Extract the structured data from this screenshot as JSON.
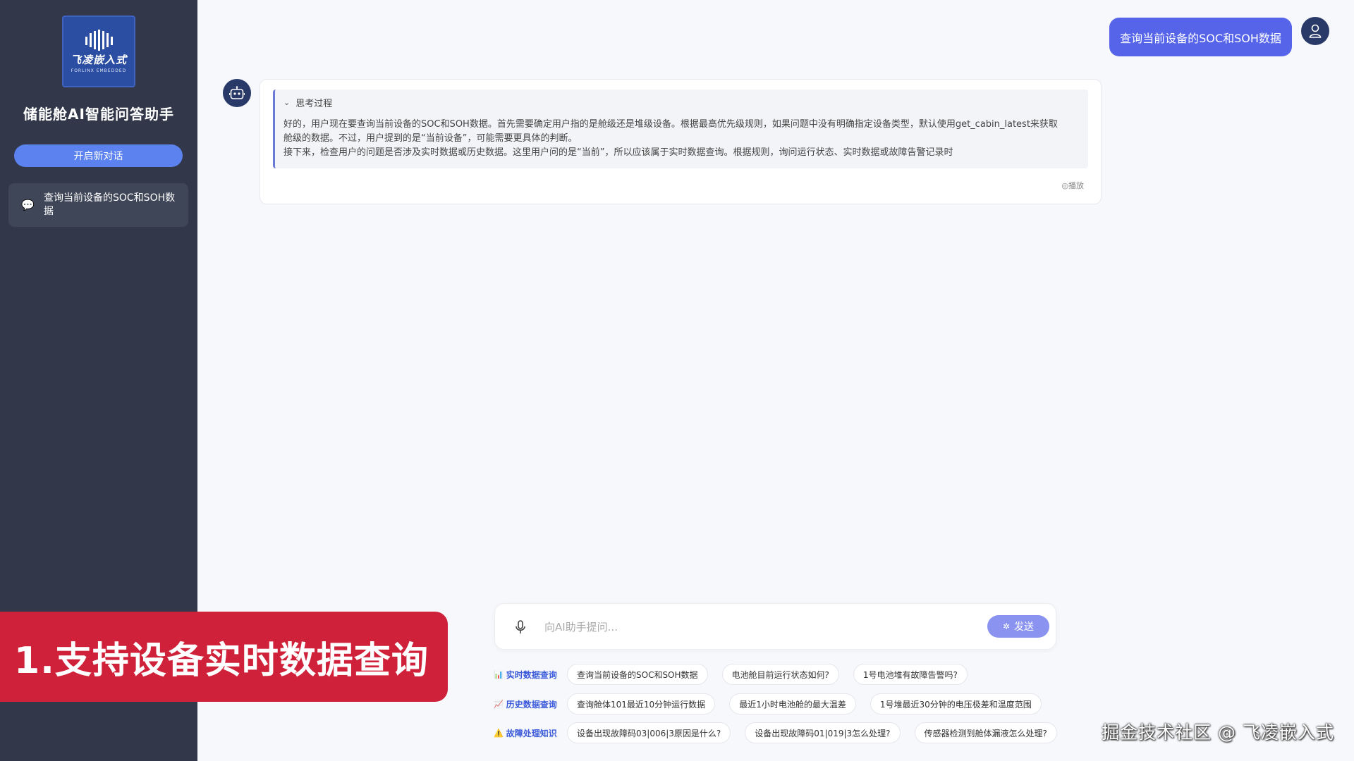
{
  "sidebar": {
    "logo_text": "飞凌嵌入式",
    "logo_sub": "FORLINX EMBEDDED",
    "app_title": "储能舱AI智能问答助手",
    "new_chat_label": "开启新对话",
    "history": [
      {
        "label": "查询当前设备的SOC和SOH数据"
      }
    ]
  },
  "chat": {
    "user_message": "查询当前设备的SOC和SOH数据",
    "think_title": "思考过程",
    "think_lines": [
      "好的，用户现在要查询当前设备的SOC和SOH数据。首先需要确定用户指的是舱级还是堆级设备。根据最高优先级规则，如果问题中没有明确指定设备类型，默认使用get_cabin_latest来获取",
      "舱级的数据。不过，用户提到的是“当前设备”，可能需要更具体的判断。",
      "接下来，检查用户的问题是否涉及实时数据或历史数据。这里用户问的是“当前”，所以应该属于实时数据查询。根据规则，询问运行状态、实时数据或故障告警记录时"
    ],
    "play_label": "◎播放"
  },
  "input": {
    "placeholder": "向AI助手提问...",
    "send_label": "发送"
  },
  "quick": [
    {
      "icon": "bar-chart-icon",
      "label": "实时数据查询",
      "chips": [
        "查询当前设备的SOC和SOH数据",
        "电池舱目前运行状态如何?",
        "1号电池堆有故障告警吗?"
      ]
    },
    {
      "icon": "trend-chart-icon",
      "label": "历史数据查询",
      "chips": [
        "查询舱体101最近10分钟运行数据",
        "最近1小时电池舱的最大温差",
        "1号堆最近30分钟的电压极差和温度范围"
      ]
    },
    {
      "icon": "warning-icon",
      "label": "故障处理知识",
      "chips": [
        "设备出现故障码03|006|3原因是什么?",
        "设备出现故障码01|019|3怎么处理?",
        "传感器检测到舱体漏液怎么处理?"
      ]
    }
  ],
  "overlay": {
    "banner": "1.支持设备实时数据查询",
    "watermark": "掘金技术社区 @ 飞凌嵌入式"
  },
  "colors": {
    "sidebar_bg": "#323849",
    "accent": "#5564e8",
    "banner": "#d0213a"
  }
}
